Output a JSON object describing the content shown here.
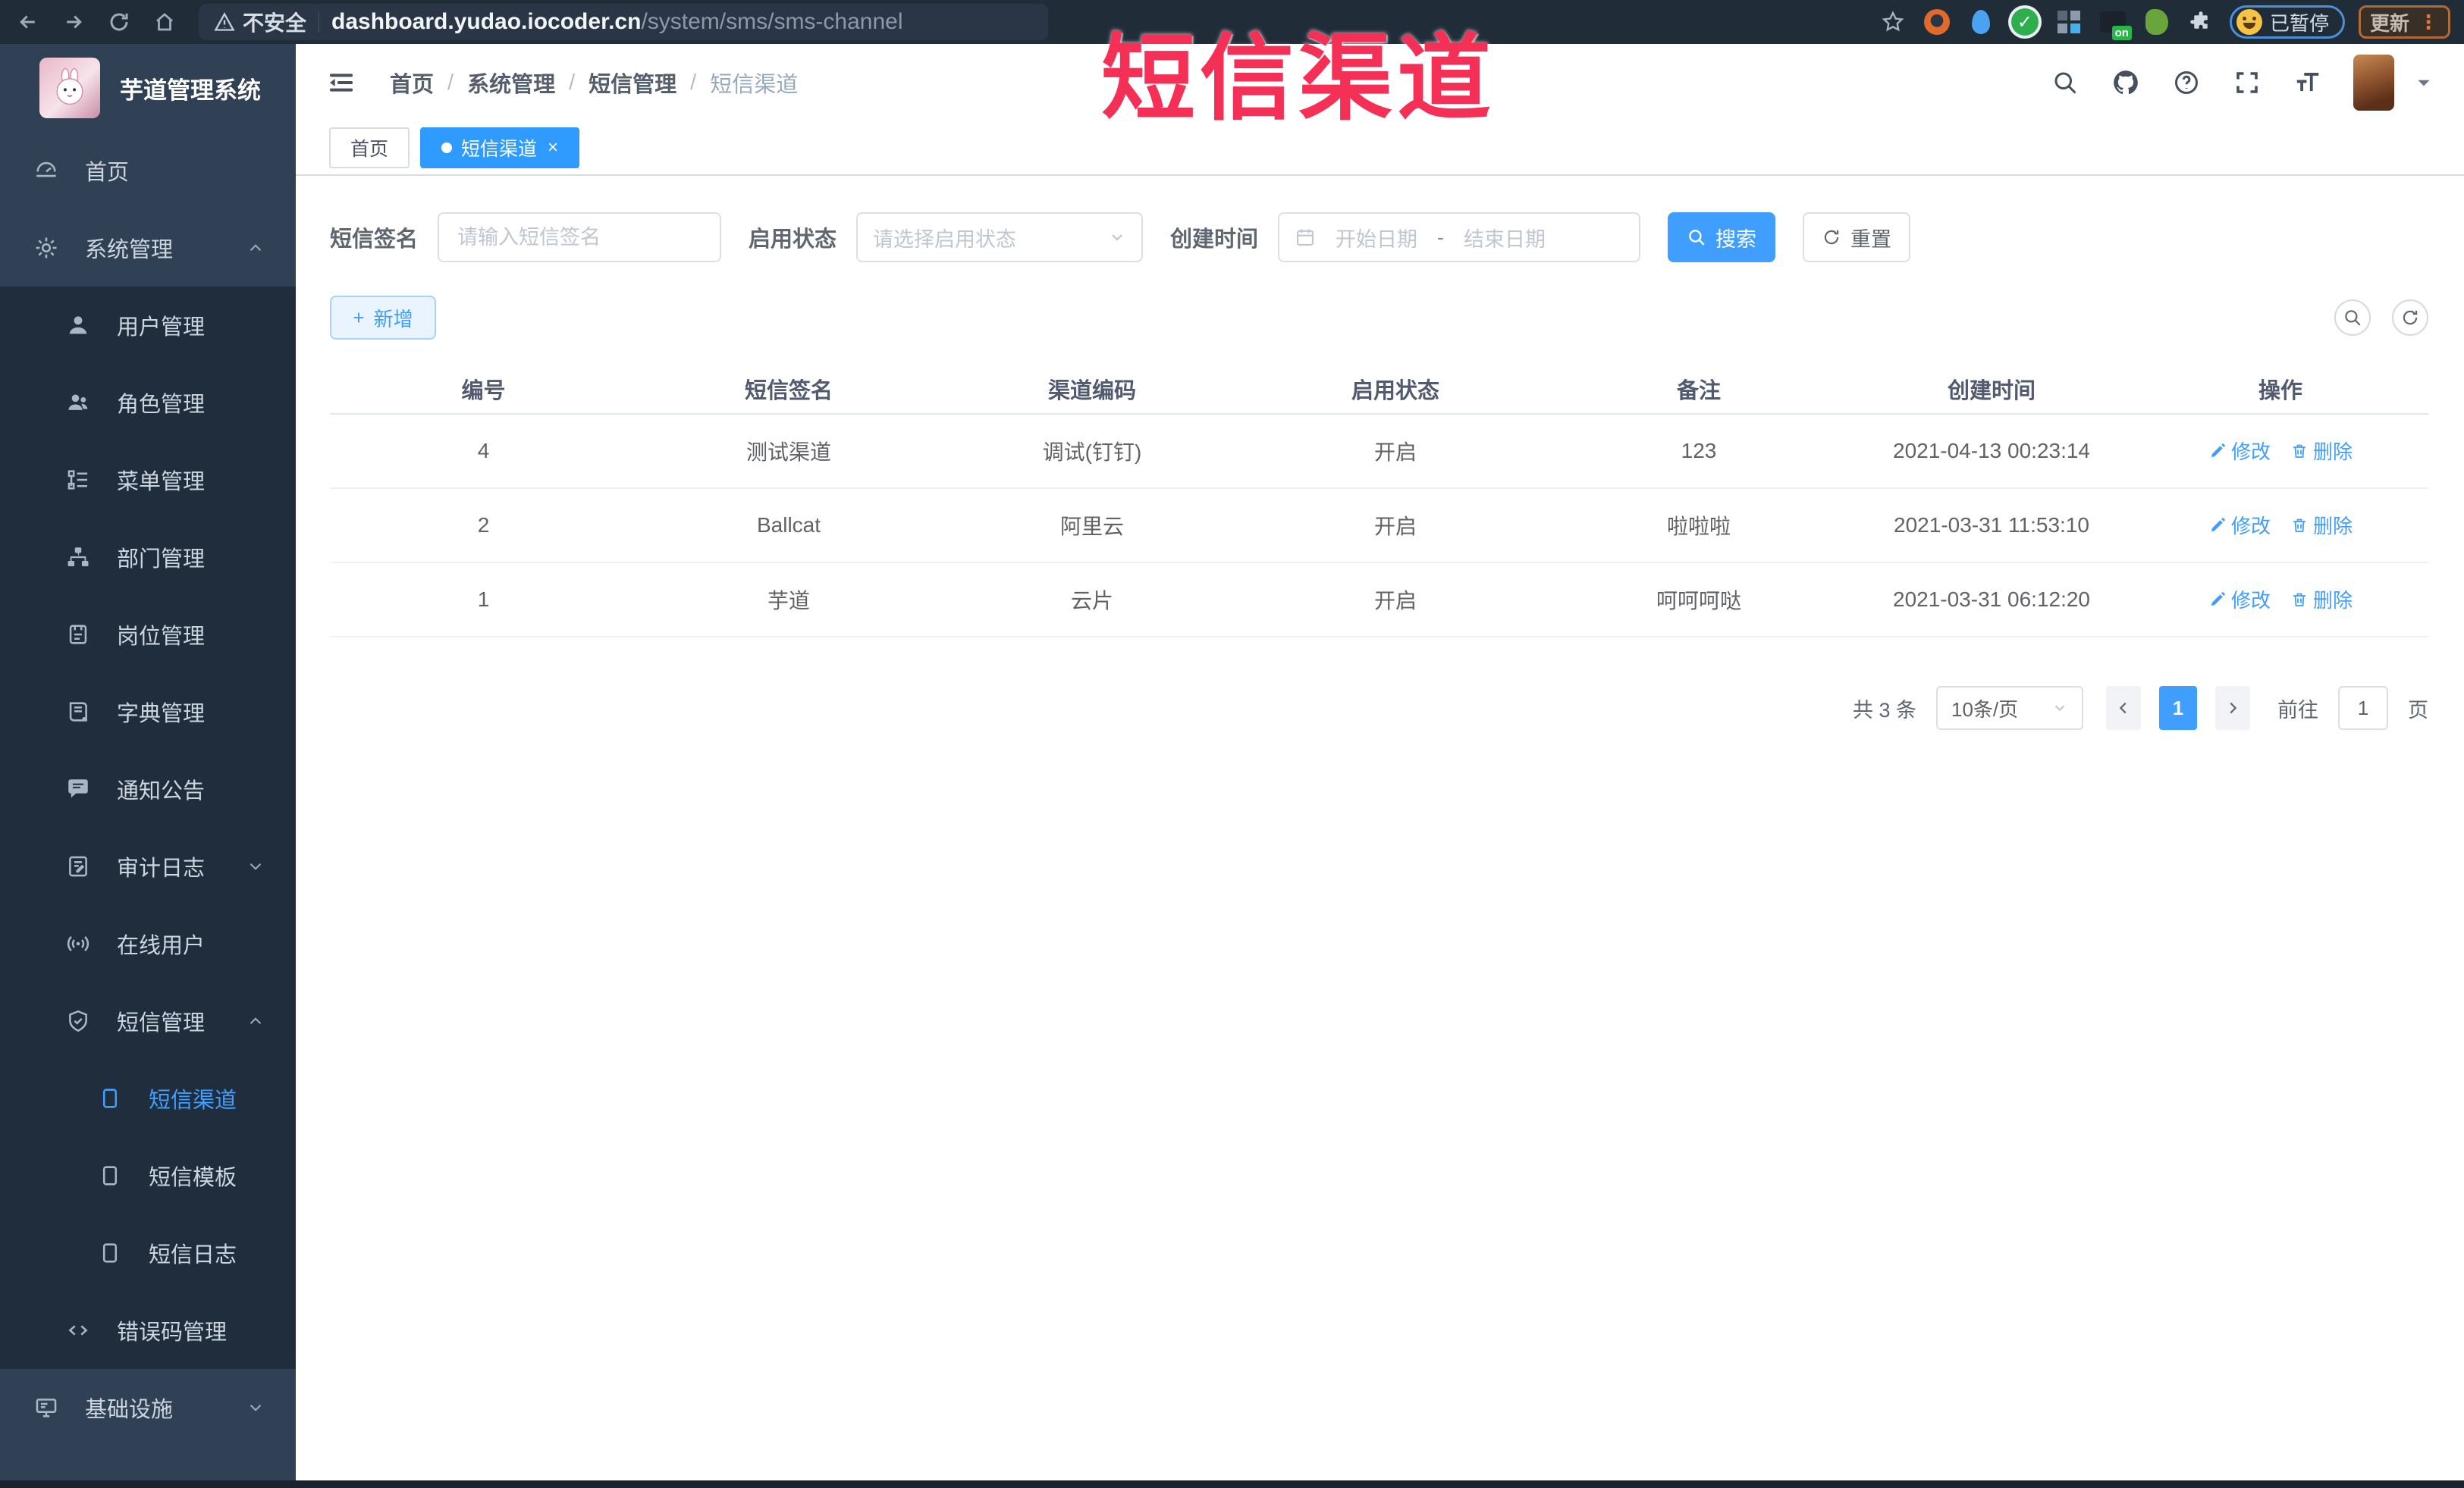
{
  "browser": {
    "security_label": "不安全",
    "url_domain": "dashboard.yudao.iocoder.cn",
    "url_path": "/system/sms/sms-channel",
    "paused_badge": "已暂停",
    "update_button": "更新",
    "update_menu_dots": "⋮"
  },
  "annotation": {
    "text": "短信渠道"
  },
  "sidebar": {
    "app_title": "芋道管理系统",
    "items": [
      {
        "label": "首页",
        "icon": "dashboard-icon",
        "level": 1,
        "section": "light"
      },
      {
        "label": "系统管理",
        "icon": "gear-icon",
        "level": 1,
        "section": "light",
        "chevron": "up"
      },
      {
        "label": "用户管理",
        "icon": "user-icon",
        "level": 2
      },
      {
        "label": "角色管理",
        "icon": "role-icon",
        "level": 2
      },
      {
        "label": "菜单管理",
        "icon": "menu-tree-icon",
        "level": 2
      },
      {
        "label": "部门管理",
        "icon": "dept-icon",
        "level": 2
      },
      {
        "label": "岗位管理",
        "icon": "post-icon",
        "level": 2
      },
      {
        "label": "字典管理",
        "icon": "dict-icon",
        "level": 2
      },
      {
        "label": "通知公告",
        "icon": "notice-icon",
        "level": 2
      },
      {
        "label": "审计日志",
        "icon": "audit-icon",
        "level": 2,
        "chevron": "down"
      },
      {
        "label": "在线用户",
        "icon": "online-icon",
        "level": 2
      },
      {
        "label": "短信管理",
        "icon": "sms-icon",
        "level": 2,
        "chevron": "up"
      },
      {
        "label": "短信渠道",
        "icon": "phone-icon",
        "level": 3,
        "active": true
      },
      {
        "label": "短信模板",
        "icon": "phone-icon",
        "level": 3
      },
      {
        "label": "短信日志",
        "icon": "phone-icon",
        "level": 3
      },
      {
        "label": "错误码管理",
        "icon": "code-icon",
        "level": 2
      },
      {
        "label": "基础设施",
        "icon": "infra-icon",
        "level": 1,
        "section": "light",
        "chevron": "down"
      }
    ]
  },
  "header": {
    "breadcrumbs": [
      "首页",
      "系统管理",
      "短信管理",
      "短信渠道"
    ]
  },
  "tabs": [
    {
      "label": "首页",
      "active": false,
      "closable": false
    },
    {
      "label": "短信渠道",
      "active": true,
      "closable": true,
      "close_glyph": "×"
    }
  ],
  "filters": {
    "sign_label": "短信签名",
    "sign_placeholder": "请输入短信签名",
    "status_label": "启用状态",
    "status_placeholder": "请选择启用状态",
    "time_label": "创建时间",
    "start_placeholder": "开始日期",
    "range_separator": "-",
    "end_placeholder": "结束日期",
    "search_label": "搜索",
    "reset_label": "重置"
  },
  "toolbar": {
    "add_label": "新增",
    "add_plus": "+"
  },
  "table": {
    "columns": [
      "编号",
      "短信签名",
      "渠道编码",
      "启用状态",
      "备注",
      "创建时间",
      "操作"
    ],
    "rows": [
      {
        "id": "4",
        "sign": "测试渠道",
        "code": "调试(钉钉)",
        "status": "开启",
        "remark": "123",
        "created": "2021-04-13 00:23:14"
      },
      {
        "id": "2",
        "sign": "Ballcat",
        "code": "阿里云",
        "status": "开启",
        "remark": "啦啦啦",
        "created": "2021-03-31 11:53:10"
      },
      {
        "id": "1",
        "sign": "芋道",
        "code": "云片",
        "status": "开启",
        "remark": "呵呵呵哒",
        "created": "2021-03-31 06:12:20"
      }
    ],
    "edit_label": "修改",
    "delete_label": "删除"
  },
  "pagination": {
    "total_text": "共 3 条",
    "page_size": "10条/页",
    "current_page": "1",
    "goto_label": "前往",
    "goto_value": "1",
    "page_unit": "页"
  },
  "colors": {
    "accent": "#409EFF",
    "sidebar_bg": "#304156",
    "sidebar_submenu_bg": "#1f2d3d",
    "annotation_red": "#f43057"
  }
}
